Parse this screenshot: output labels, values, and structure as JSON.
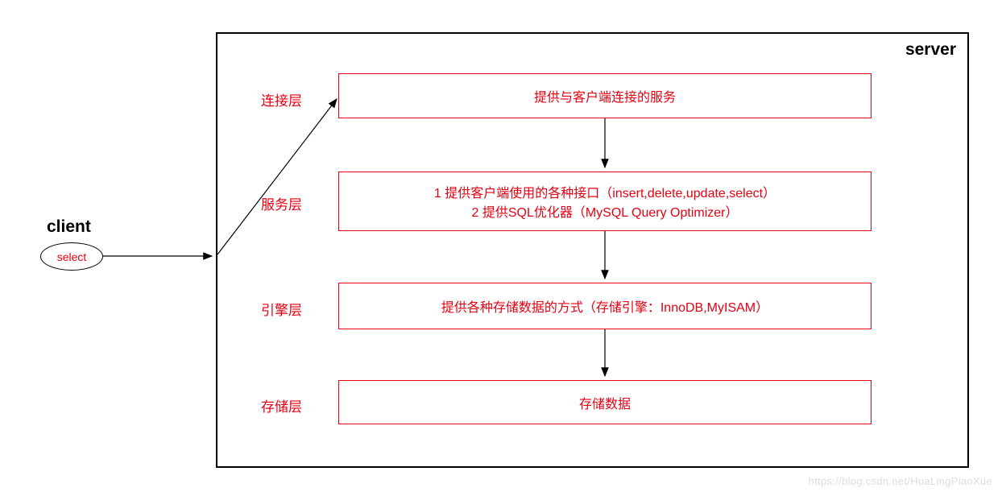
{
  "client": {
    "title": "client",
    "node_text": "select"
  },
  "server": {
    "title": "server",
    "layers": [
      {
        "name": "连接层",
        "lines": [
          "提供与客户端连接的服务"
        ]
      },
      {
        "name": "服务层",
        "lines": [
          "1 提供客户端使用的各种接口（insert,delete,update,select）",
          "2 提供SQL优化器（MySQL Query Optimizer）"
        ]
      },
      {
        "name": "引擎层",
        "lines": [
          "提供各种存储数据的方式（存储引擎：InnoDB,MyISAM）"
        ]
      },
      {
        "name": "存储层",
        "lines": [
          "存储数据"
        ]
      }
    ]
  },
  "watermark": "https://blog.csdn.net/HuaLingPiaoXue"
}
